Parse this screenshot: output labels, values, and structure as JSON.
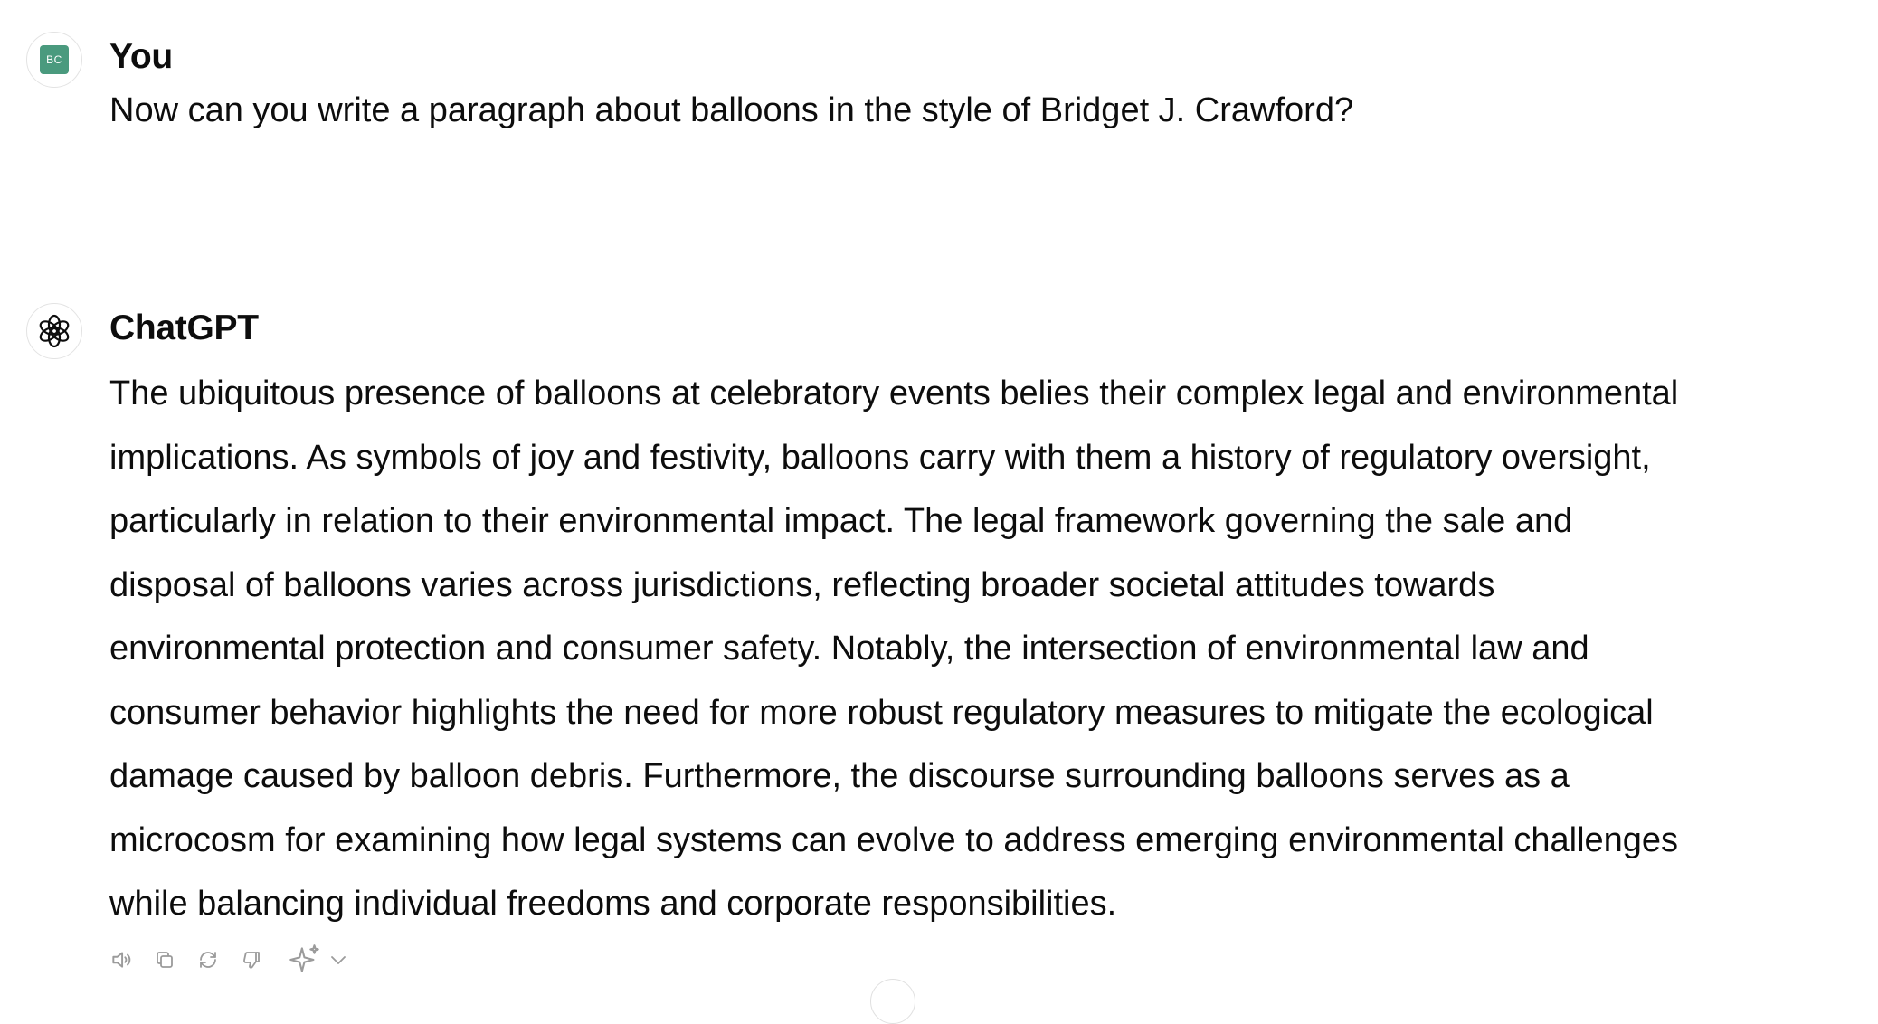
{
  "conversation": {
    "user": {
      "author": "You",
      "avatar_initials": "BC",
      "avatar_color": "#4a9a7e",
      "message": "Now can you write a paragraph about balloons in the style of Bridget J. Crawford?"
    },
    "assistant": {
      "author": "ChatGPT",
      "avatar_icon": "openai-logo-icon",
      "message_lines": [
        "The ubiquitous presence of balloons at celebratory events belies their complex legal and environmental",
        "implications. As symbols of joy and festivity, balloons carry with them a history of regulatory oversight,",
        "particularly in relation to their environmental impact. The legal framework governing the sale and",
        "disposal of balloons varies across jurisdictions, reflecting broader societal attitudes towards",
        "environmental protection and consumer safety. Notably, the intersection of environmental law and",
        "consumer behavior highlights the need for more robust regulatory measures to mitigate the ecological",
        "damage caused by balloon debris. Furthermore, the discourse surrounding balloons serves as a",
        "microcosm for examining how legal systems can evolve to address emerging environmental challenges",
        "while balancing individual freedoms and corporate responsibilities."
      ]
    }
  },
  "actions": {
    "icons": [
      "read-aloud-icon",
      "copy-icon",
      "regenerate-icon",
      "thumbs-down-icon",
      "sparkle-icon",
      "chevron-down-icon"
    ],
    "icon_color": "#9b9b9b"
  }
}
